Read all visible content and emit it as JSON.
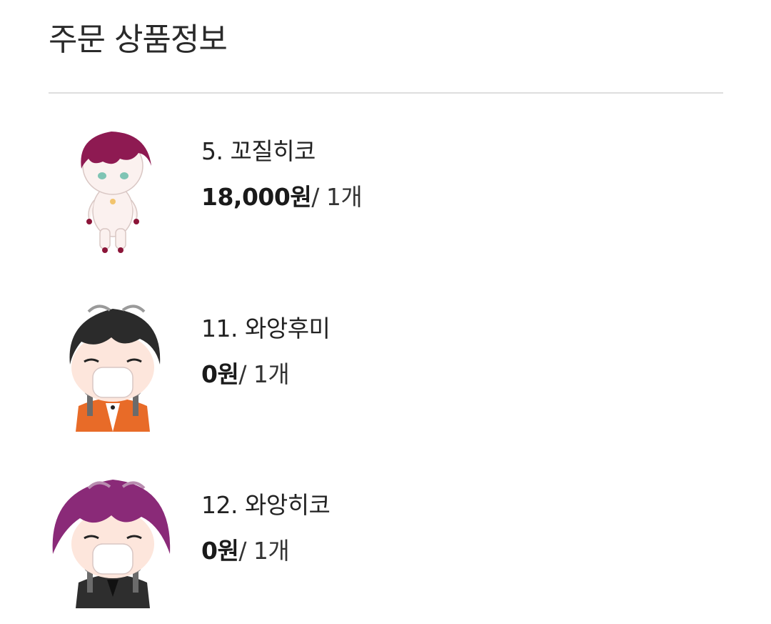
{
  "header": {
    "title": "주문 상품정보"
  },
  "items": [
    {
      "name": "5. 꼬질히코",
      "price": "18,000원",
      "quantity": "/ 1개",
      "thumbnail": "full-body-doll-red-hair"
    },
    {
      "name": "11. 와앙후미",
      "price": "0원",
      "quantity": "/ 1개",
      "thumbnail": "chibi-black-hair-eating"
    },
    {
      "name": "12. 와앙히코",
      "price": "0원",
      "quantity": "/ 1개",
      "thumbnail": "chibi-purple-hair-eating"
    }
  ],
  "colors": {
    "divider": "#dedede",
    "text": "#222222"
  }
}
